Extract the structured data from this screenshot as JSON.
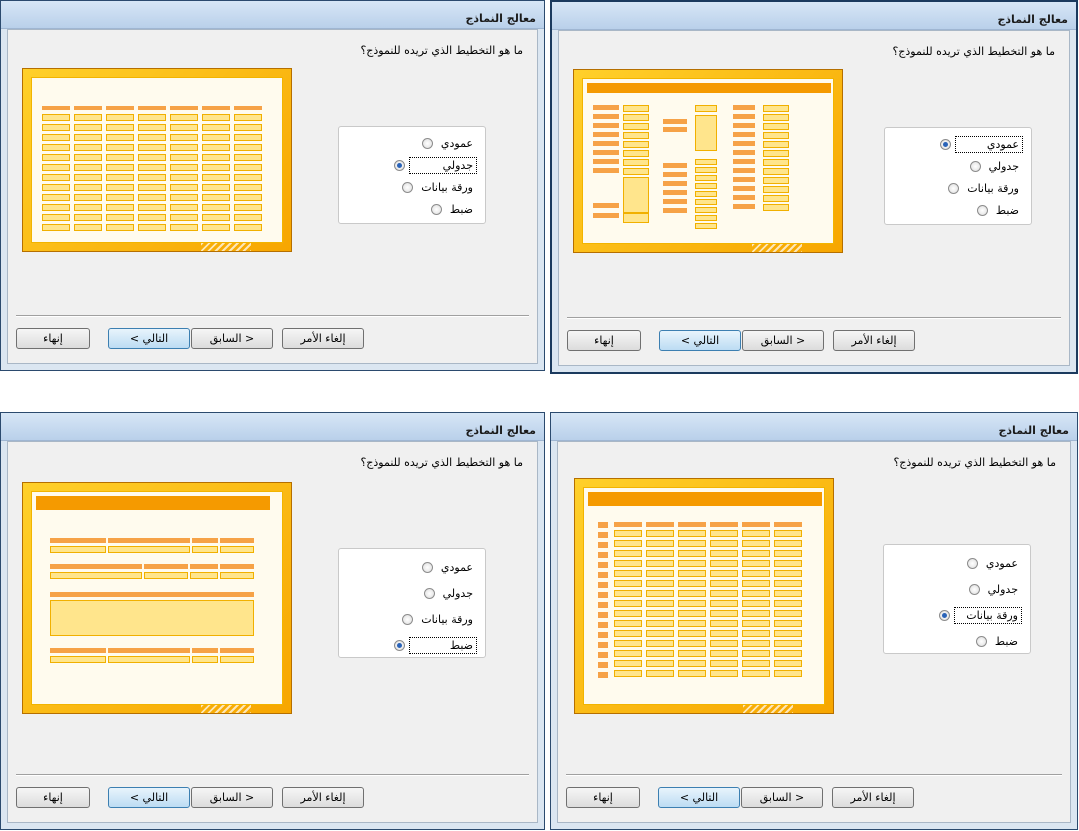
{
  "windows": [
    {
      "id": "tabular",
      "title": "معالج النماذج",
      "question": "ما هو التخطيط الذي تريده للنموذج؟",
      "layout_preview": "tabular-layout-preview",
      "options": [
        "عمودي",
        "جدولي",
        "ورقة بيانات",
        "ضبط"
      ],
      "selected": "جدولي",
      "buttons": {
        "cancel": "إلغاء الأمر",
        "back": "< السابق",
        "next": "التالي >",
        "finish": "إنهاء"
      }
    },
    {
      "id": "columnar",
      "title": "معالج النماذج",
      "question": "ما هو التخطيط الذي تريده للنموذج؟",
      "layout_preview": "columnar-layout-preview",
      "options": [
        "عمودي",
        "جدولي",
        "ورقة بيانات",
        "ضبط"
      ],
      "selected": "عمودي",
      "buttons": {
        "cancel": "إلغاء الأمر",
        "back": "< السابق",
        "next": "التالي >",
        "finish": "إنهاء"
      }
    },
    {
      "id": "justified",
      "title": "معالج النماذج",
      "question": "ما هو التخطيط الذي تريده للنموذج؟",
      "layout_preview": "justified-layout-preview",
      "options": [
        "عمودي",
        "جدولي",
        "ورقة بيانات",
        "ضبط"
      ],
      "selected": "ضبط",
      "buttons": {
        "cancel": "إلغاء الأمر",
        "back": "< السابق",
        "next": "التالي >",
        "finish": "إنهاء"
      }
    },
    {
      "id": "datasheet",
      "title": "معالج النماذج",
      "question": "ما هو التخطيط الذي تريده للنموذج؟",
      "layout_preview": "datasheet-layout-preview",
      "options": [
        "عمودي",
        "جدولي",
        "ورقة بيانات",
        "ضبط"
      ],
      "selected": "ورقة بيانات",
      "buttons": {
        "cancel": "إلغاء الأمر",
        "back": "< السابق",
        "next": "التالي >",
        "finish": "إنهاء"
      }
    }
  ],
  "colors": {
    "accent_orange": "#f7a600",
    "field_yellow": "#ffe58c",
    "title_bar": "#b9d0ea"
  }
}
